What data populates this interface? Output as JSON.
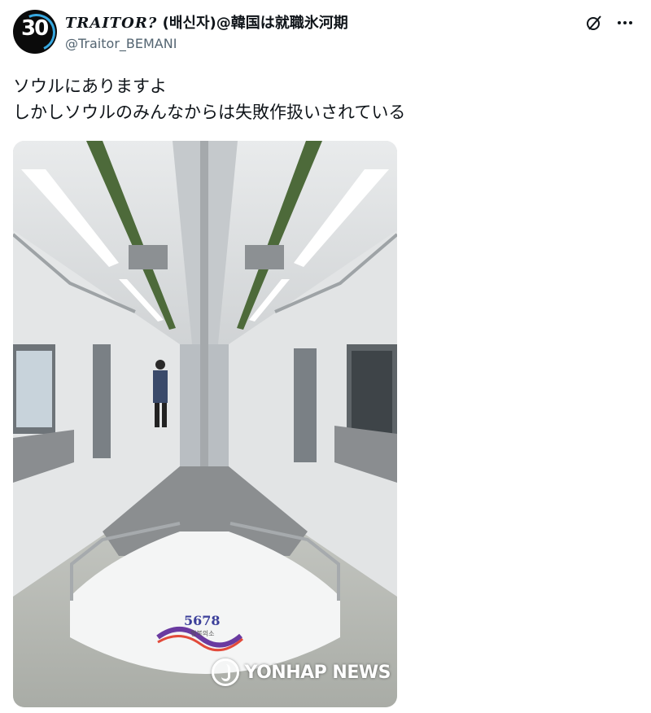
{
  "author": {
    "display_name_brand": "TRAITOR?",
    "display_name_rest": " (배신자)@韓国は就職氷河期",
    "handle": "@Traitor_BEMANI",
    "avatar_text": "30"
  },
  "tweet": {
    "lines": [
      "ソウルにありますよ",
      "しかしソウルのみんなからは失敗作扱いされている"
    ]
  },
  "photo": {
    "seat_number": "5678",
    "seat_caption": "행복의소",
    "watermark": "YONHAP NEWS"
  },
  "icons": {
    "grok": "grok-icon",
    "more": "more-icon"
  }
}
